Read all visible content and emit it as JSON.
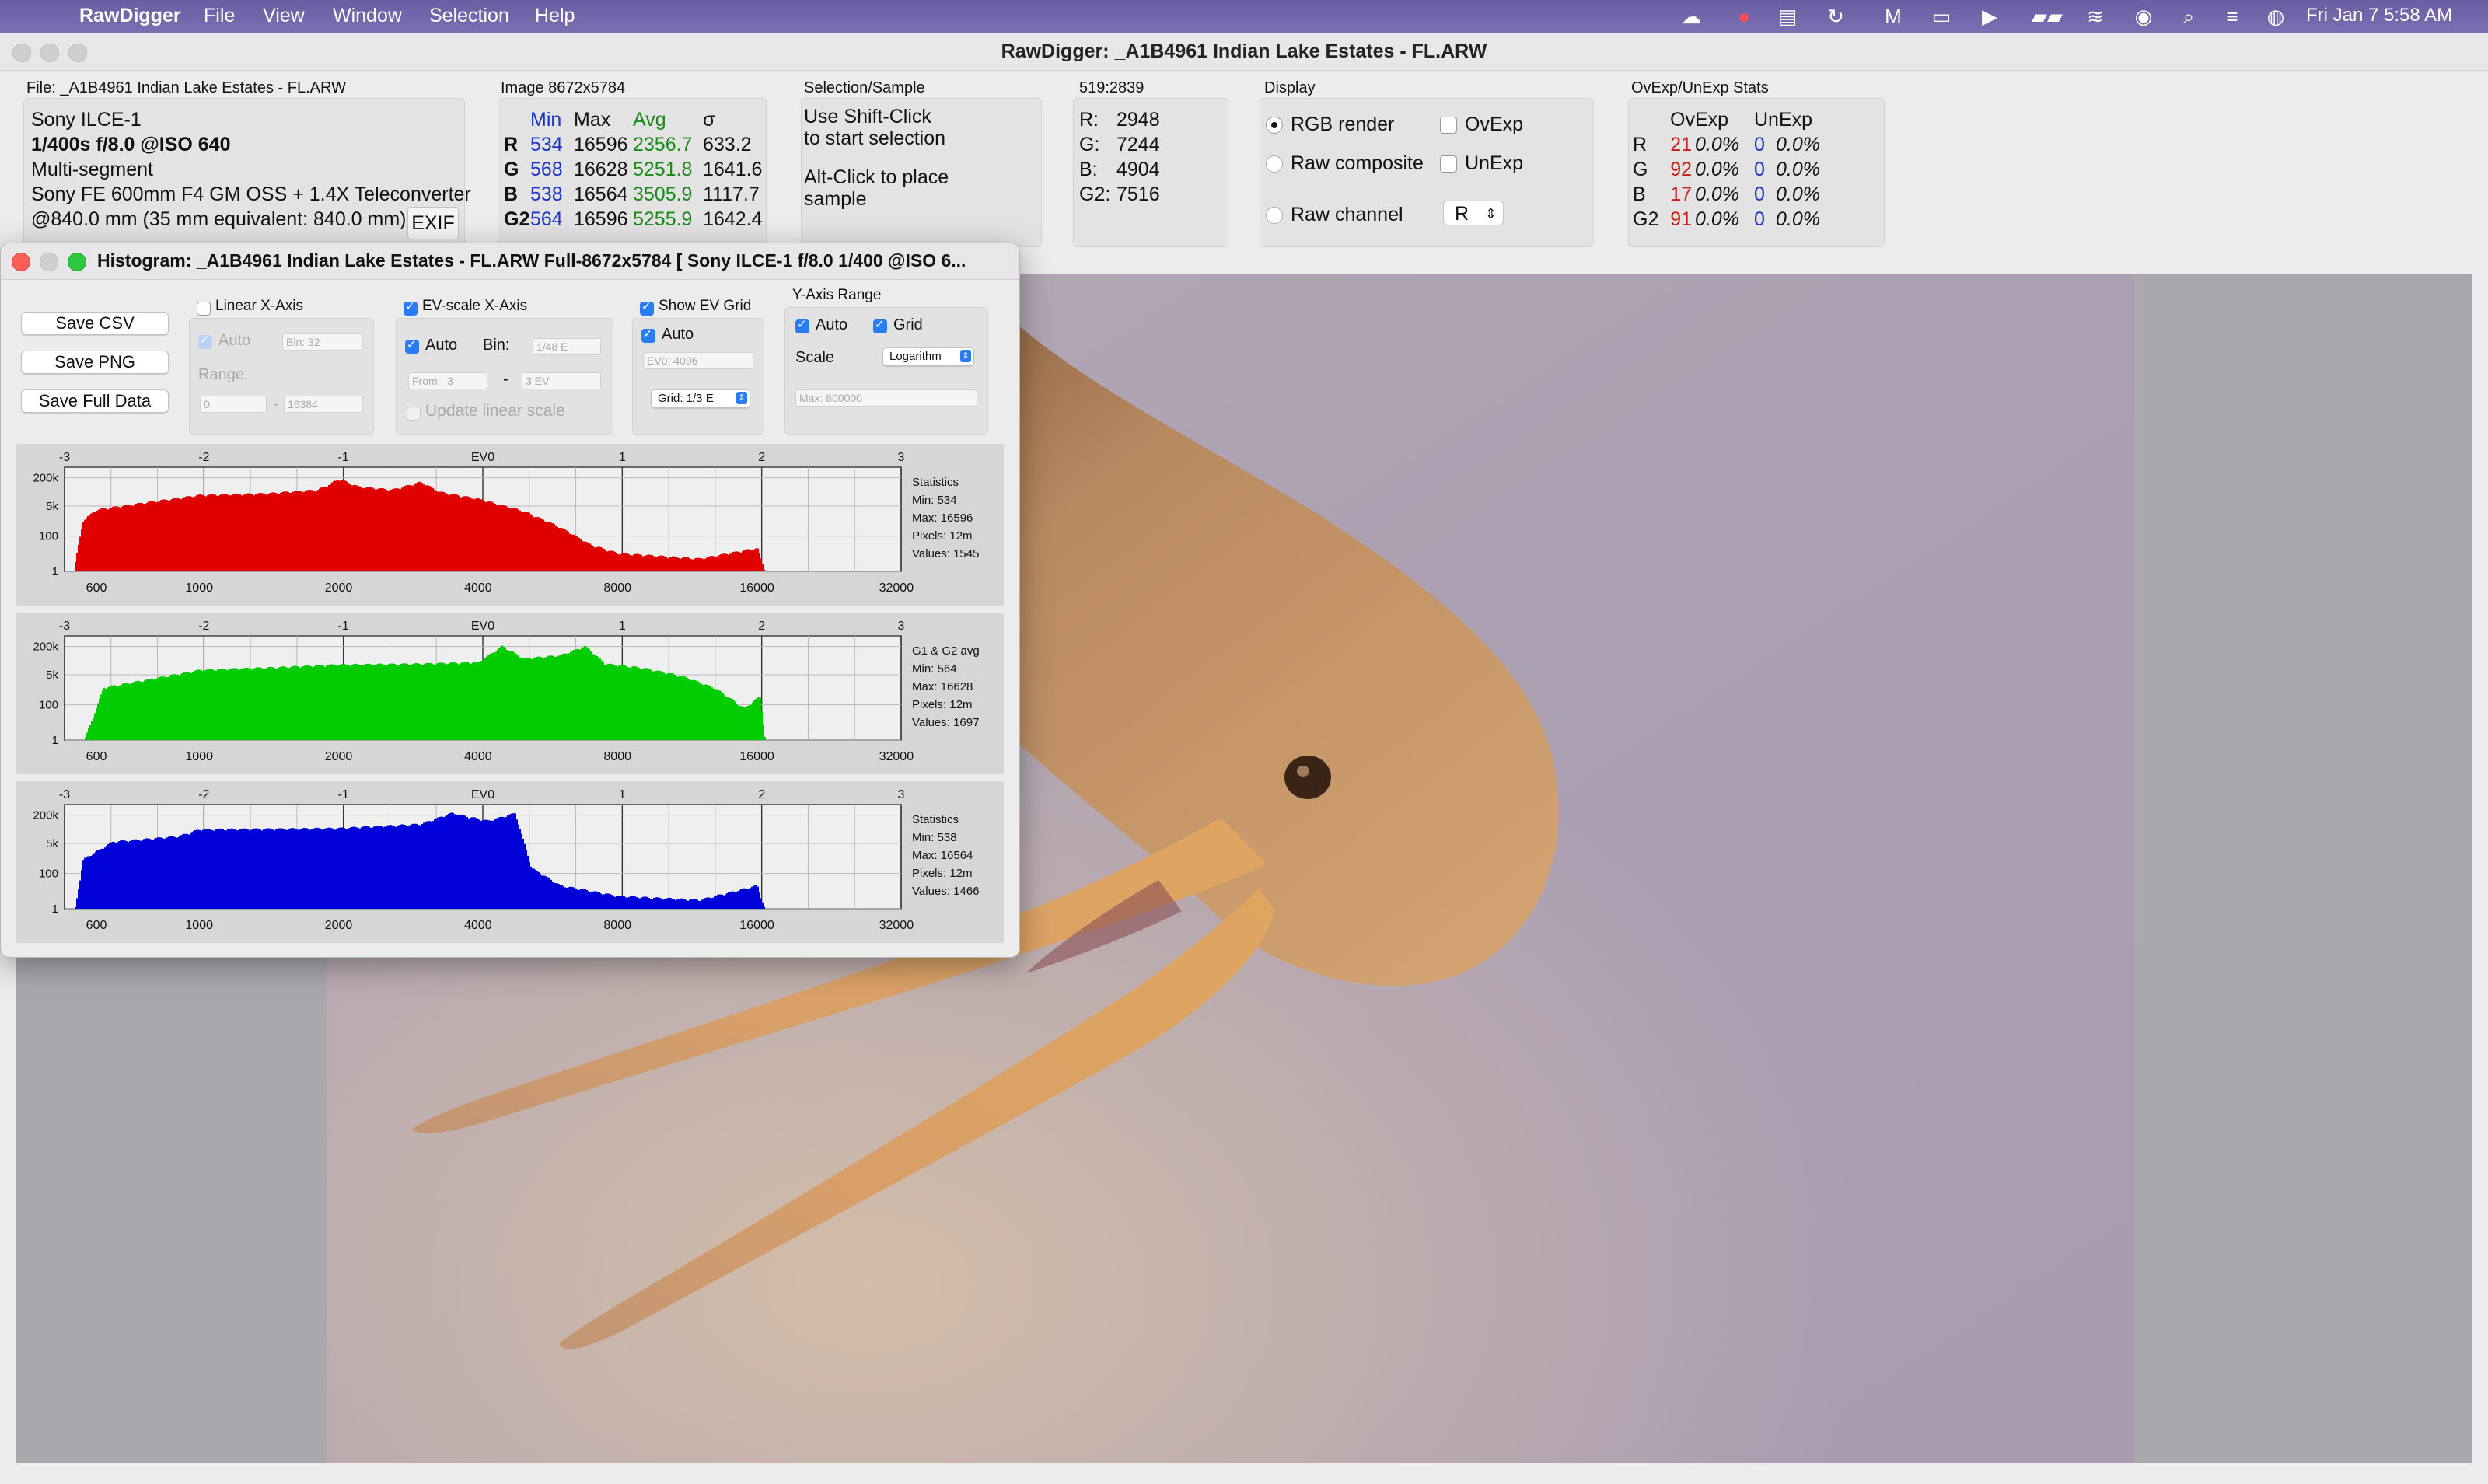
{
  "menubar": {
    "app": "RawDigger",
    "items": [
      "File",
      "View",
      "Window",
      "Selection",
      "Help"
    ],
    "clock": "Fri Jan 7  5:58 AM"
  },
  "window": {
    "title": "RawDigger: _A1B4961 Indian Lake Estates - FL.ARW"
  },
  "file_panel": {
    "label": "File: _A1B4961 Indian Lake Estates - FL.ARW",
    "camera": "Sony ILCE-1",
    "exposure": "1/400s f/8.0 @ISO 640",
    "mode": "Multi-segment",
    "lens": "Sony FE 600mm F4 GM OSS + 1.4X Teleconverter",
    "focal": "@840.0 mm (35 mm equivalent: 840.0 mm)",
    "exif_button": "EXIF"
  },
  "image_panel": {
    "label": "Image 8672x5784",
    "headers": [
      "Min",
      "Max",
      "Avg",
      "σ"
    ],
    "rows": [
      {
        "ch": "R",
        "min": "534",
        "max": "16596",
        "avg": "2356.7",
        "sd": "633.2"
      },
      {
        "ch": "G",
        "min": "568",
        "max": "16628",
        "avg": "5251.8",
        "sd": "1641.6"
      },
      {
        "ch": "B",
        "min": "538",
        "max": "16564",
        "avg": "3505.9",
        "sd": "1117.7"
      },
      {
        "ch": "G2",
        "min": "564",
        "max": "16596",
        "avg": "5255.9",
        "sd": "1642.4"
      }
    ]
  },
  "selection_panel": {
    "label": "Selection/Sample",
    "line1": "Use Shift-Click",
    "line2": "to start selection",
    "line3": "Alt-Click to place",
    "line4": "sample"
  },
  "sample_panel": {
    "label": "519:2839",
    "rows": [
      {
        "k": "R:",
        "v": "2948"
      },
      {
        "k": "G:",
        "v": "7244"
      },
      {
        "k": "B:",
        "v": "4904"
      },
      {
        "k": "G2:",
        "v": "7516"
      }
    ]
  },
  "display_panel": {
    "label": "Display",
    "rgb_render": "RGB render",
    "raw_composite": "Raw composite",
    "raw_channel": "Raw channel",
    "ovexp": "OvExp",
    "unexp": "UnExp",
    "channel_select": "R"
  },
  "stats_panel": {
    "label": "OvExp/UnExp Stats",
    "head_ov": "OvExp",
    "head_un": "UnExp",
    "rows": [
      {
        "ch": "R",
        "ov_n": "21",
        "ov_p": "0.0%",
        "un_n": "0",
        "un_p": "0.0%"
      },
      {
        "ch": "G",
        "ov_n": "92",
        "ov_p": "0.0%",
        "un_n": "0",
        "un_p": "0.0%"
      },
      {
        "ch": "B",
        "ov_n": "17",
        "ov_p": "0.0%",
        "un_n": "0",
        "un_p": "0.0%"
      },
      {
        "ch": "G2",
        "ov_n": "91",
        "ov_p": "0.0%",
        "un_n": "0",
        "un_p": "0.0%"
      }
    ]
  },
  "histogram": {
    "title": "Histogram: _A1B4961 Indian Lake Estates - FL.ARW Full-8672x5784 [ Sony ILCE-1 f/8.0 1/400 @ISO 6...",
    "save_csv": "Save CSV",
    "save_png": "Save PNG",
    "save_full": "Save Full Data",
    "linear_x": "Linear X-Axis",
    "auto": "Auto",
    "bin_placeholder": "Bin: 32",
    "range": "Range:",
    "range_from": "0",
    "range_to": "16384",
    "ev_scale": "EV-scale X-Axis",
    "bin": "Bin:",
    "bin_value": "1/48 E",
    "from_placeholder": "From: -3",
    "to_placeholder": "3 EV",
    "dash": "-",
    "update_linear": "Update linear scale",
    "show_ev_grid": "Show EV Grid",
    "ev0_placeholder": "EV0: 4096",
    "grid_select": "Grid: 1/3 E",
    "y_axis_range": "Y-Axis Range",
    "grid": "Grid",
    "scale": "Scale",
    "scale_select": "Logarithm",
    "max_placeholder": "Max: 800000"
  },
  "chart_data": [
    {
      "type": "area",
      "series": [
        {
          "name": "R",
          "color": "#e00000"
        }
      ],
      "ev_ticks": [
        "-3",
        "-2",
        "-1",
        "EV0",
        "1",
        "2",
        "3"
      ],
      "x_ticks": [
        "600",
        "1000",
        "2000",
        "4000",
        "8000",
        "16000",
        "32000"
      ],
      "y_ticks": [
        "200k",
        "5k",
        "100",
        "1"
      ],
      "stats_label": "Statistics",
      "stats": [
        "Min: 534",
        "Max: 16596",
        "Pixels: 12m",
        "Values: 1545"
      ],
      "x_scale": "log",
      "y_scale": "log",
      "grid": true,
      "stats_min": 534,
      "profile": [
        [
          534,
          1
        ],
        [
          560,
          800
        ],
        [
          600,
          3000
        ],
        [
          800,
          9000
        ],
        [
          1000,
          20000
        ],
        [
          1400,
          25000
        ],
        [
          1800,
          40000
        ],
        [
          2000,
          160000
        ],
        [
          2200,
          60000
        ],
        [
          2600,
          40000
        ],
        [
          3000,
          110000
        ],
        [
          3300,
          30000
        ],
        [
          4000,
          12000
        ],
        [
          5000,
          2500
        ],
        [
          6000,
          300
        ],
        [
          7000,
          30
        ],
        [
          8000,
          10
        ],
        [
          12000,
          5
        ],
        [
          16000,
          20
        ],
        [
          16596,
          1
        ]
      ]
    },
    {
      "type": "area",
      "series": [
        {
          "name": "G1 & G2 avg",
          "color": "#00cc00"
        }
      ],
      "ev_ticks": [
        "-3",
        "-2",
        "-1",
        "EV0",
        "1",
        "2",
        "3"
      ],
      "x_ticks": [
        "600",
        "1000",
        "2000",
        "4000",
        "8000",
        "16000",
        "32000"
      ],
      "y_ticks": [
        "200k",
        "5k",
        "100",
        "1"
      ],
      "stats_label": "G1 & G2 avg",
      "stats": [
        "Min: 564",
        "Max: 16628",
        "Pixels: 12m",
        "Values: 1697"
      ],
      "x_scale": "log",
      "y_scale": "log",
      "grid": true,
      "stats_min": 564,
      "profile": [
        [
          564,
          1
        ],
        [
          620,
          900
        ],
        [
          800,
          3000
        ],
        [
          1000,
          9000
        ],
        [
          1500,
          13000
        ],
        [
          2000,
          18000
        ],
        [
          3000,
          20000
        ],
        [
          4000,
          25000
        ],
        [
          4500,
          200000
        ],
        [
          5000,
          40000
        ],
        [
          6000,
          60000
        ],
        [
          6800,
          200000
        ],
        [
          7500,
          20000
        ],
        [
          9000,
          12000
        ],
        [
          11000,
          4000
        ],
        [
          13000,
          800
        ],
        [
          15000,
          60
        ],
        [
          16200,
          300
        ],
        [
          16628,
          1
        ]
      ]
    },
    {
      "type": "area",
      "series": [
        {
          "name": "B",
          "color": "#0000d8"
        }
      ],
      "ev_ticks": [
        "-3",
        "-2",
        "-1",
        "EV0",
        "1",
        "2",
        "3"
      ],
      "x_ticks": [
        "600",
        "1000",
        "2000",
        "4000",
        "8000",
        "16000",
        "32000"
      ],
      "y_ticks": [
        "200k",
        "5k",
        "100",
        "1"
      ],
      "stats_label": "Statistics",
      "stats": [
        "Min: 538",
        "Max: 16564",
        "Pixels: 12m",
        "Values: 1466"
      ],
      "x_scale": "log",
      "y_scale": "log",
      "grid": true,
      "stats_min": 538,
      "profile": [
        [
          538,
          1
        ],
        [
          560,
          600
        ],
        [
          650,
          6000
        ],
        [
          900,
          12000
        ],
        [
          1000,
          30000
        ],
        [
          1500,
          32000
        ],
        [
          2000,
          35000
        ],
        [
          3000,
          60000
        ],
        [
          3500,
          250000
        ],
        [
          4200,
          90000
        ],
        [
          4800,
          250000
        ],
        [
          5200,
          200
        ],
        [
          6000,
          20
        ],
        [
          8000,
          5
        ],
        [
          12000,
          3
        ],
        [
          16000,
          20
        ],
        [
          16564,
          1
        ]
      ]
    }
  ]
}
